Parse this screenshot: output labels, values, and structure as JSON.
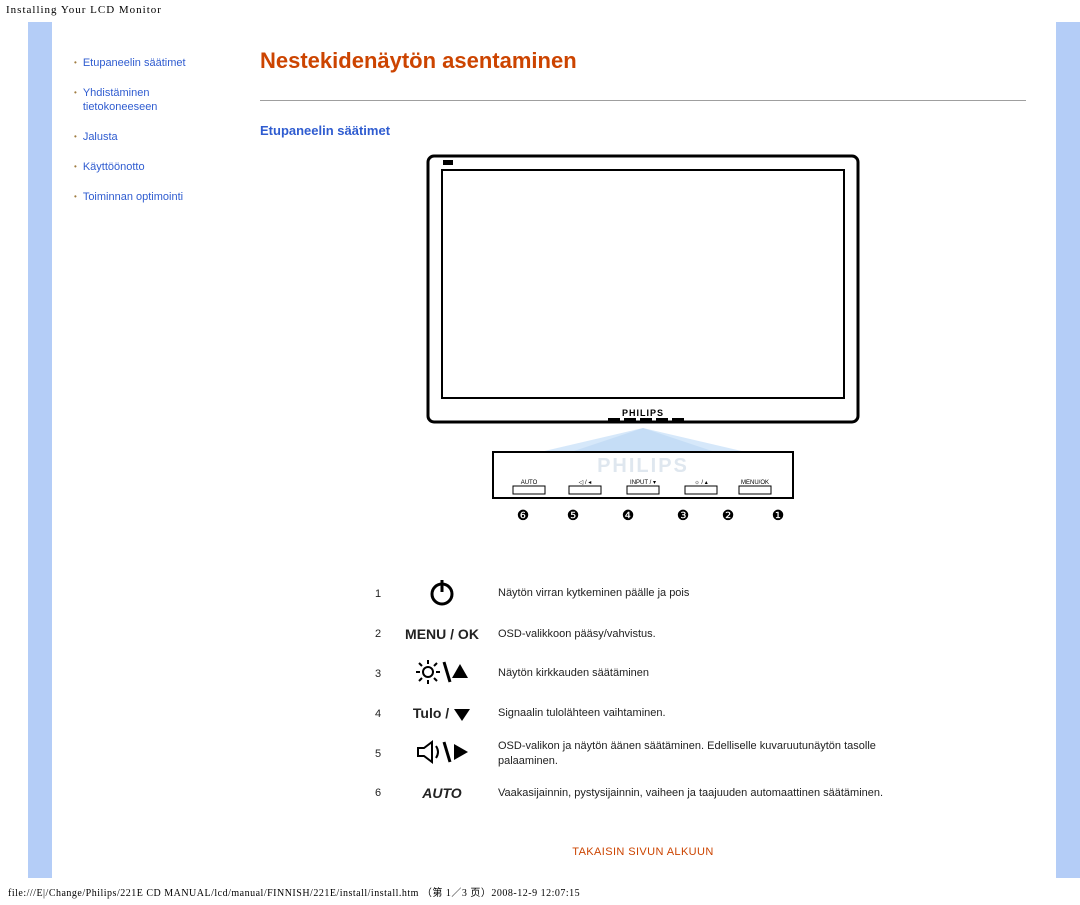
{
  "header": {
    "pagetab": "Installing Your LCD Monitor"
  },
  "sidebar": {
    "items": [
      {
        "label": "Etupaneelin säätimet"
      },
      {
        "label": "Yhdistäminen tietokoneeseen"
      },
      {
        "label": "Jalusta"
      },
      {
        "label": "Käyttöönotto"
      },
      {
        "label": "Toiminnan optimointi"
      }
    ]
  },
  "main": {
    "title": "Nestekidenäytön asentaminen",
    "section_heading": "Etupaneelin säätimet",
    "brand": "PHILIPS",
    "panel_labels": {
      "l0": "AUTO",
      "l1": "◁ / ◂",
      "l2": "INPUT / ▾",
      "l3": "☼ / ▴",
      "l4": "MENU/OK"
    },
    "panel_numbers": [
      "❻",
      "❺",
      "❹",
      "❸",
      "❷",
      "❶"
    ],
    "controls": [
      {
        "num": "1",
        "icon_name": "power-icon",
        "label": "",
        "desc": "Näytön virran kytkeminen päälle ja pois"
      },
      {
        "num": "2",
        "icon_name": "menu-ok-label",
        "label": "MENU / OK",
        "desc": "OSD-valikkoon pääsy/vahvistus."
      },
      {
        "num": "3",
        "icon_name": "brightness-up-icon",
        "label": "",
        "desc": "Näytön kirkkauden säätäminen"
      },
      {
        "num": "4",
        "icon_name": "input-down-label",
        "label": "Tulo / ",
        "desc": "Signaalin tulolähteen vaihtaminen."
      },
      {
        "num": "5",
        "icon_name": "volume-left-icon",
        "label": "",
        "desc": "OSD-valikon ja näytön äänen säätäminen. Edelliselle kuvaruutunäytön tasolle palaaminen."
      },
      {
        "num": "6",
        "icon_name": "auto-label",
        "label": "AUTO",
        "desc": "Vaakasijainnin, pystysijainnin, vaiheen ja taajuuden automaattinen säätäminen."
      }
    ],
    "back_to_top": "TAKAISIN SIVUN ALKUUN"
  },
  "footer": {
    "path": "file:///E|/Change/Philips/221E CD MANUAL/lcd/manual/FINNISH/221E/install/install.htm （第 1／3 页）2008-12-9 12:07:15"
  }
}
